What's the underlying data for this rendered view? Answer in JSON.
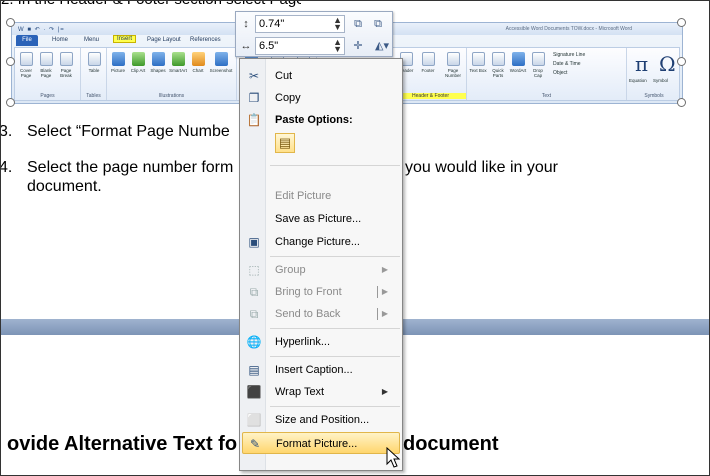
{
  "document": {
    "top_partial_line": "2. In the Header & Footer section select Page Number",
    "step3": {
      "number": "3.",
      "text": "Select “Format Page Numbe"
    },
    "step4": {
      "number": "4.",
      "line1_left": "Select the page number form",
      "line1_right": "you would like in your",
      "line2": "document."
    },
    "heading_left": "ovide Alternative Text fo",
    "heading_right": "document"
  },
  "ribbon_picture": {
    "window_title": "Accessible Word Documents TOW.docx - Microsoft Word",
    "quick_access": "W ■ ↶ · ↷ |=",
    "tabs": [
      "File",
      "Home",
      "Menu",
      "Insert",
      "Page Layout",
      "References"
    ],
    "active_tab": "Insert",
    "groups": [
      "Pages",
      "Tables",
      "Illustrations",
      "Header & Footer",
      "Text",
      "Symbols"
    ],
    "buttons": {
      "pages": [
        "Cover Page",
        "Blank Page",
        "Page Break"
      ],
      "tables": [
        "Table"
      ],
      "illustrations": [
        "Picture",
        "Clip Art",
        "Shapes",
        "SmartArt",
        "Chart",
        "Screenshot"
      ],
      "links": [
        "Hyperlink",
        "Bookmark",
        "Cross-reference"
      ],
      "header_footer": [
        "Header",
        "Footer",
        "Page Number"
      ],
      "text": [
        "Text Box",
        "Quick Parts",
        "WordArt",
        "Drop Cap"
      ],
      "text_side": [
        "Signature Line",
        "Date & Time",
        "Object"
      ],
      "symbols": [
        "Equation",
        "Symbol"
      ]
    },
    "symbol_glyphs": [
      "π",
      "Ω"
    ]
  },
  "mini_toolbar": {
    "height_value": "0.74\"",
    "width_value": "6.5\""
  },
  "context_menu": {
    "items": [
      {
        "label": "Cut",
        "icon": "scissors-icon",
        "glyph": "✂",
        "disabled": false
      },
      {
        "label": "Copy",
        "icon": "copy-icon",
        "glyph": "❐",
        "disabled": false
      },
      {
        "label": "Paste Options:",
        "icon": "paste-icon",
        "glyph": "📋",
        "disabled": false,
        "header": true
      },
      {
        "label": "Edit Picture",
        "disabled": true
      },
      {
        "label": "Save as Picture...",
        "disabled": false
      },
      {
        "label": "Change Picture...",
        "icon": "change-picture-icon",
        "glyph": "▣",
        "disabled": false
      },
      {
        "label": "Group",
        "icon": "group-icon",
        "glyph": "⬚",
        "disabled": true,
        "submenu": true
      },
      {
        "label": "Bring to Front",
        "icon": "bring-front-icon",
        "glyph": "⧉",
        "disabled": true,
        "submenu": true
      },
      {
        "label": "Send to Back",
        "icon": "send-back-icon",
        "glyph": "⧉",
        "disabled": true,
        "submenu": true
      },
      {
        "label": "Hyperlink...",
        "icon": "hyperlink-icon",
        "glyph": "🌐",
        "disabled": false
      },
      {
        "label": "Insert Caption...",
        "icon": "caption-icon",
        "glyph": "▤",
        "disabled": false
      },
      {
        "label": "Wrap Text",
        "icon": "wrap-text-icon",
        "glyph": "⬛",
        "disabled": false,
        "submenu": true
      },
      {
        "label": "Size and Position...",
        "icon": "size-position-icon",
        "glyph": "⬜",
        "disabled": false
      },
      {
        "label": "Format Picture...",
        "icon": "format-picture-icon",
        "glyph": "✎",
        "disabled": false,
        "hovered": true
      }
    ]
  },
  "colors": {
    "highlight_yellow": "#ffff4f",
    "menu_hover": "#ffd66e",
    "ribbon_blue": "#2a62b8",
    "divider_band": "#8aa0c0"
  }
}
